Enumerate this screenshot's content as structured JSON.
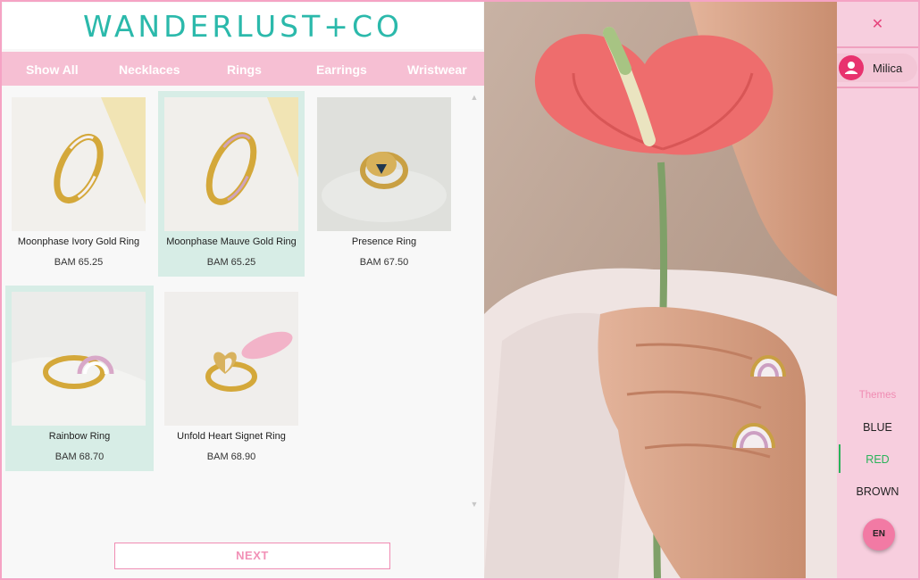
{
  "header": {
    "logo": "WANDERLUST+CO"
  },
  "nav": {
    "items": [
      "Show All",
      "Necklaces",
      "Rings",
      "Earrings",
      "Wristwear"
    ]
  },
  "products": [
    {
      "name": "Moonphase Ivory Gold Ring",
      "price": "BAM 65.25"
    },
    {
      "name": "Moonphase Mauve Gold Ring",
      "price": "BAM 65.25"
    },
    {
      "name": "Presence Ring",
      "price": "BAM 67.50"
    },
    {
      "name": "Rainbow Ring",
      "price": "BAM 68.70"
    },
    {
      "name": "Unfold Heart Signet Ring",
      "price": "BAM 68.90"
    }
  ],
  "pagination": {
    "next_label": "NEXT"
  },
  "sidebar": {
    "close_icon": "close-icon",
    "user_name": "Milica",
    "themes_title": "Themes",
    "themes": [
      "BLUE",
      "RED",
      "BROWN"
    ],
    "active_theme": "RED",
    "language": "EN"
  },
  "colors": {
    "accent_teal": "#2bb9ab",
    "accent_pink": "#f08cb3",
    "active_green": "#2bb35a"
  }
}
